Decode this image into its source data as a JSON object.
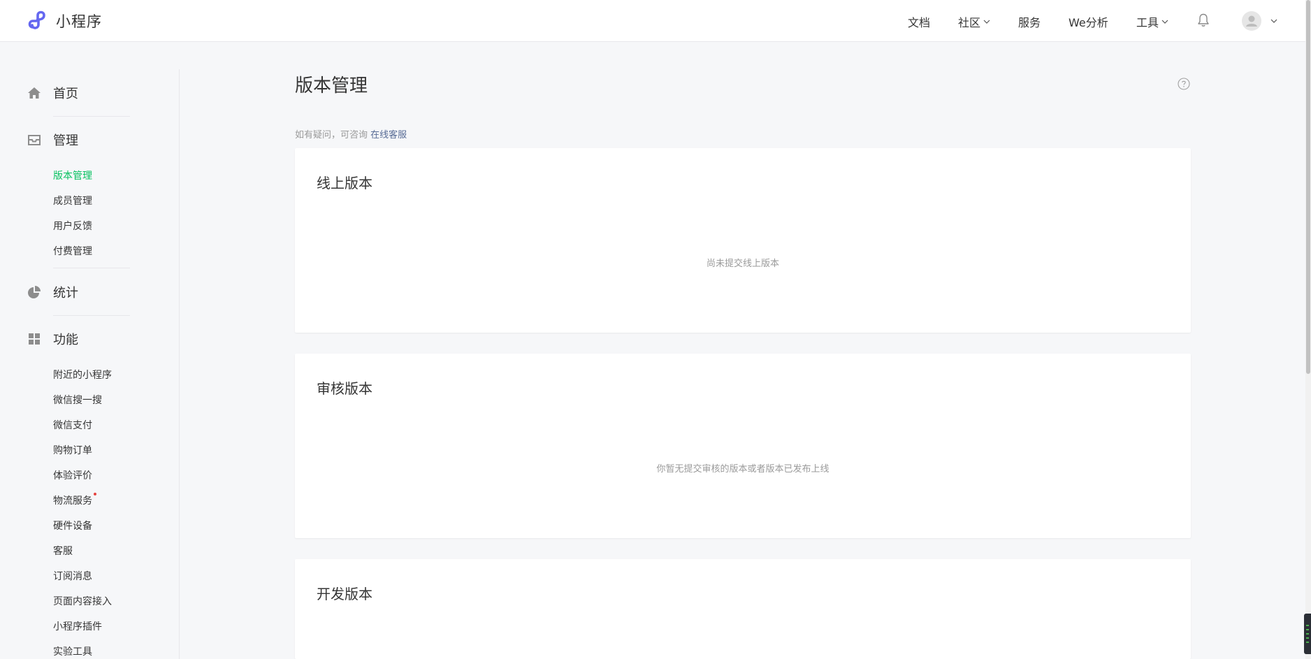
{
  "brand": {
    "name": "小程序"
  },
  "nav": {
    "docs": "文档",
    "community": "社区",
    "service": "服务",
    "analytics": "We分析",
    "tools": "工具"
  },
  "sidebar": {
    "home": "首页",
    "manage": {
      "label": "管理",
      "items": [
        "版本管理",
        "成员管理",
        "用户反馈",
        "付费管理"
      ]
    },
    "stats": "统计",
    "features": {
      "label": "功能",
      "items": [
        "附近的小程序",
        "微信搜一搜",
        "微信支付",
        "购物订单",
        "体验评价",
        "物流服务",
        "硬件设备",
        "客服",
        "订阅消息",
        "页面内容接入",
        "小程序插件",
        "实验工具"
      ]
    },
    "active_item": "版本管理"
  },
  "main": {
    "title": "版本管理",
    "tip_text": "如有疑问，可咨询",
    "tip_link": "在线客服",
    "cards": [
      {
        "title": "线上版本",
        "empty": "尚未提交线上版本"
      },
      {
        "title": "审核版本",
        "empty": "你暂无提交审核的版本或者版本已发布上线"
      },
      {
        "title": "开发版本",
        "empty": ""
      }
    ]
  },
  "colors": {
    "accent": "#07c160",
    "link": "#576b95",
    "brand_logo": "#6467f0"
  },
  "icons": {
    "brand": "miniprogram-logo-icon",
    "home": "home-icon",
    "manage": "inbox-icon",
    "stats": "pie-chart-icon",
    "features": "grid-icon",
    "bell": "bell-icon",
    "help": "question-circle-icon"
  }
}
